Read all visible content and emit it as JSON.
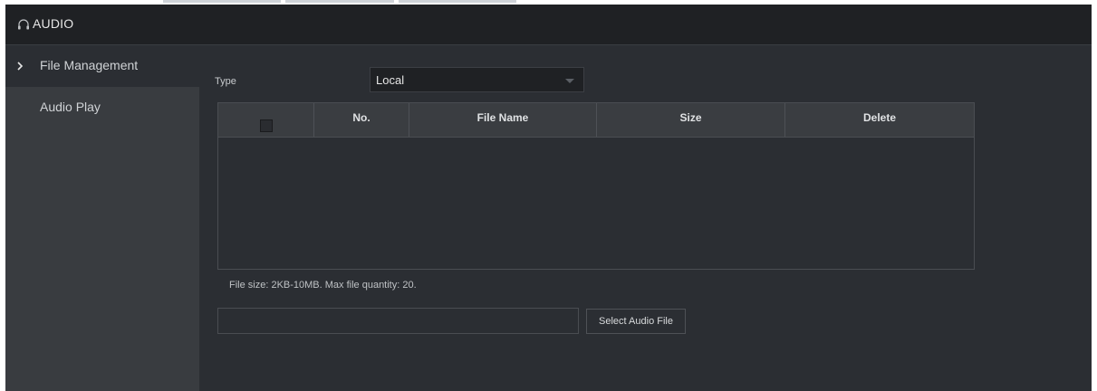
{
  "header": {
    "title": "AUDIO",
    "icon": "headphones-icon"
  },
  "sidebar": {
    "items": [
      {
        "label": "File Management",
        "active": true
      },
      {
        "label": "Audio Play",
        "active": false
      }
    ]
  },
  "form": {
    "type_label": "Type",
    "type_value": "Local"
  },
  "table": {
    "columns": [
      "No.",
      "File Name",
      "Size",
      "Delete"
    ],
    "rows": []
  },
  "note": "File size: 2KB-10MB. Max file quantity: 20.",
  "upload": {
    "path_value": "",
    "button_label": "Select Audio File"
  },
  "colors": {
    "header_bg": "#1f2124",
    "panel_bg": "#2b2e33",
    "sidebar_bg": "#393c40",
    "text": "#e6e6e6"
  }
}
